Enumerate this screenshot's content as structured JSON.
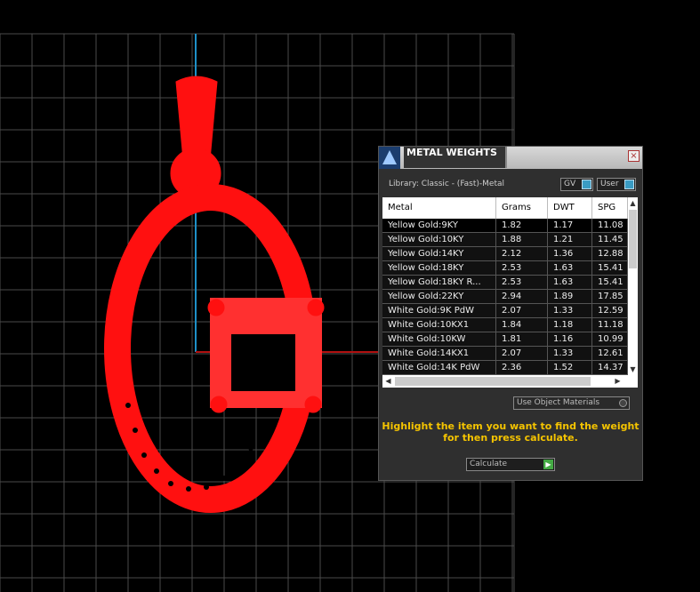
{
  "panel": {
    "title": "METAL WEIGHTS",
    "close_icon": "×",
    "library_label": "Library: Classic - (Fast)-Metal",
    "gv_toggle": "GV",
    "user_toggle": "User",
    "columns": [
      "Metal",
      "Grams",
      "DWT",
      "SPG"
    ],
    "rows": [
      {
        "metal": "Yellow Gold:9KY",
        "grams": "1.82",
        "dwt": "1.17",
        "spg": "11.08"
      },
      {
        "metal": "Yellow Gold:10KY",
        "grams": "1.88",
        "dwt": "1.21",
        "spg": "11.45"
      },
      {
        "metal": "Yellow Gold:14KY",
        "grams": "2.12",
        "dwt": "1.36",
        "spg": "12.88"
      },
      {
        "metal": "Yellow Gold:18KY",
        "grams": "2.53",
        "dwt": "1.63",
        "spg": "15.41"
      },
      {
        "metal": "Yellow Gold:18KY R...",
        "grams": "2.53",
        "dwt": "1.63",
        "spg": "15.41"
      },
      {
        "metal": "Yellow Gold:22KY",
        "grams": "2.94",
        "dwt": "1.89",
        "spg": "17.85"
      },
      {
        "metal": "White Gold:9K PdW",
        "grams": "2.07",
        "dwt": "1.33",
        "spg": "12.59"
      },
      {
        "metal": "White Gold:10KX1",
        "grams": "1.84",
        "dwt": "1.18",
        "spg": "11.18"
      },
      {
        "metal": "White Gold:10KW",
        "grams": "1.81",
        "dwt": "1.16",
        "spg": "10.99"
      },
      {
        "metal": "White Gold:14KX1",
        "grams": "2.07",
        "dwt": "1.33",
        "spg": "12.61"
      },
      {
        "metal": "White Gold:14K PdW",
        "grams": "2.36",
        "dwt": "1.52",
        "spg": "14.37"
      }
    ],
    "use_object_materials": "Use Object Materials",
    "instruction": "Highlight the item you want to find the weight for then press calculate.",
    "calculate_label": "Calculate",
    "scroll_up": "▲",
    "scroll_down": "▼",
    "scroll_left": "◀",
    "scroll_right": "▶",
    "go_icon": "▶"
  },
  "colors": {
    "model": "#ff0000",
    "grid": "#555555",
    "axis_y": "#1e90c8",
    "axis_x": "#b01010",
    "instruction": "#f5c400"
  }
}
